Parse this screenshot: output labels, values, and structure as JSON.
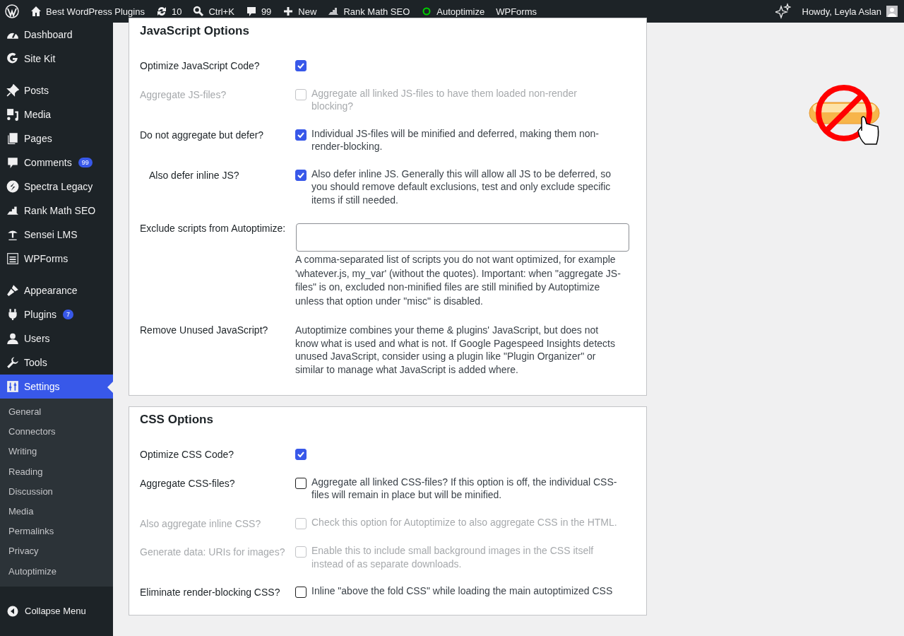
{
  "admin_bar": {
    "left": [
      {
        "label": "Best WordPress Plugins"
      },
      {
        "label": "10"
      },
      {
        "label": "Ctrl+K"
      },
      {
        "label": "99"
      },
      {
        "label": "New"
      },
      {
        "label": "Rank Math SEO"
      },
      {
        "label": "Autoptimize"
      },
      {
        "label": "WPForms"
      }
    ],
    "greeting": "Howdy, Leyla Aslan"
  },
  "sidebar": {
    "groups": [
      {
        "items": [
          {
            "label": "Dashboard",
            "selected": false
          },
          {
            "label": "Site Kit",
            "selected": false
          }
        ]
      },
      {
        "items": [
          {
            "label": "Posts",
            "selected": false
          },
          {
            "label": "Media",
            "selected": false
          },
          {
            "label": "Pages",
            "selected": false
          },
          {
            "label": "Comments",
            "selected": false,
            "badge": "99"
          },
          {
            "label": "Spectra Legacy",
            "selected": false
          },
          {
            "label": "Rank Math SEO",
            "selected": false
          },
          {
            "label": "Sensei LMS",
            "selected": false
          },
          {
            "label": "WPForms",
            "selected": false
          }
        ]
      },
      {
        "items": [
          {
            "label": "Appearance",
            "selected": false
          },
          {
            "label": "Plugins",
            "selected": false,
            "badge": "7"
          },
          {
            "label": "Users",
            "selected": false
          },
          {
            "label": "Tools",
            "selected": false
          },
          {
            "label": "Settings",
            "selected": true,
            "children": [
              {
                "label": "General",
                "selected": false
              },
              {
                "label": "Connectors",
                "selected": false
              },
              {
                "label": "Writing",
                "selected": false
              },
              {
                "label": "Reading",
                "selected": false
              },
              {
                "label": "Discussion",
                "selected": false
              },
              {
                "label": "Media",
                "selected": false
              },
              {
                "label": "Permalinks",
                "selected": false
              },
              {
                "label": "Privacy",
                "selected": false
              },
              {
                "label": "Autoptimize",
                "selected": false
              }
            ]
          }
        ]
      }
    ],
    "collapse": "Collapse Menu"
  },
  "sections": [
    {
      "title": "JavaScript Options",
      "rows": [
        {
          "kind": "checkbox",
          "label": "Optimize JavaScript Code?",
          "checked": true,
          "disabled": false
        },
        {
          "kind": "checkbox",
          "label": "Aggregate JS-files?",
          "checked": false,
          "disabled": true,
          "text": "Aggregate all linked JS-files to have them loaded non-render blocking?"
        },
        {
          "kind": "checkbox",
          "label": "Do not aggregate but defer?",
          "checked": true,
          "disabled": false,
          "text": "Individual JS-files will be minified and deferred, making them non-render-blocking."
        },
        {
          "kind": "checkbox",
          "label": "Also defer inline JS?",
          "indented": true,
          "checked": true,
          "disabled": false,
          "text": "Also defer inline JS. Generally this will allow all JS to be deferred, so you should remove default exclusions, test and only exclude specific items if still needed."
        },
        {
          "kind": "field",
          "label": "Exclude scripts from Autoptimize:",
          "text": "A comma-separated list of scripts you do not want optimized, for example 'whatever.js, my_var' (without the quotes). Important: when \"aggregate JS-files\" is on, excluded non-minified files are still minified by Autoptimize unless that option under \"misc\" is disabled."
        },
        {
          "kind": "note",
          "label": "Remove Unused JavaScript?",
          "text": "Autoptimize combines your theme & plugins' JavaScript, but does not know what is used and what is not. If Google Pagespeed Insights detects unused JavaScript, consider using a plugin like \"Plugin Organizer\" or similar to manage what JavaScript is added where."
        }
      ]
    },
    {
      "title": "CSS Options",
      "rows": [
        {
          "kind": "checkbox",
          "label": "Optimize CSS Code?",
          "checked": true,
          "disabled": false
        },
        {
          "kind": "checkbox",
          "label": "Aggregate CSS-files?",
          "checked": false,
          "disabled": false,
          "text": "Aggregate all linked CSS-files? If this option is off, the individual CSS-files will remain in place but will be minified."
        },
        {
          "kind": "checkbox",
          "label": "Also aggregate inline CSS?",
          "checked": false,
          "disabled": true,
          "text": "Check this option for Autoptimize to also aggregate CSS in the HTML."
        },
        {
          "kind": "checkbox",
          "label": "Generate data: URIs for images?",
          "checked": false,
          "disabled": true,
          "text": "Enable this to include small background images in the CSS itself instead of as separate downloads."
        },
        {
          "kind": "checkbox",
          "label": "Eliminate render-blocking CSS?",
          "checked": false,
          "disabled": false,
          "text": "Inline \"above the fold CSS\" while loading the main autoptimized CSS"
        }
      ]
    }
  ]
}
